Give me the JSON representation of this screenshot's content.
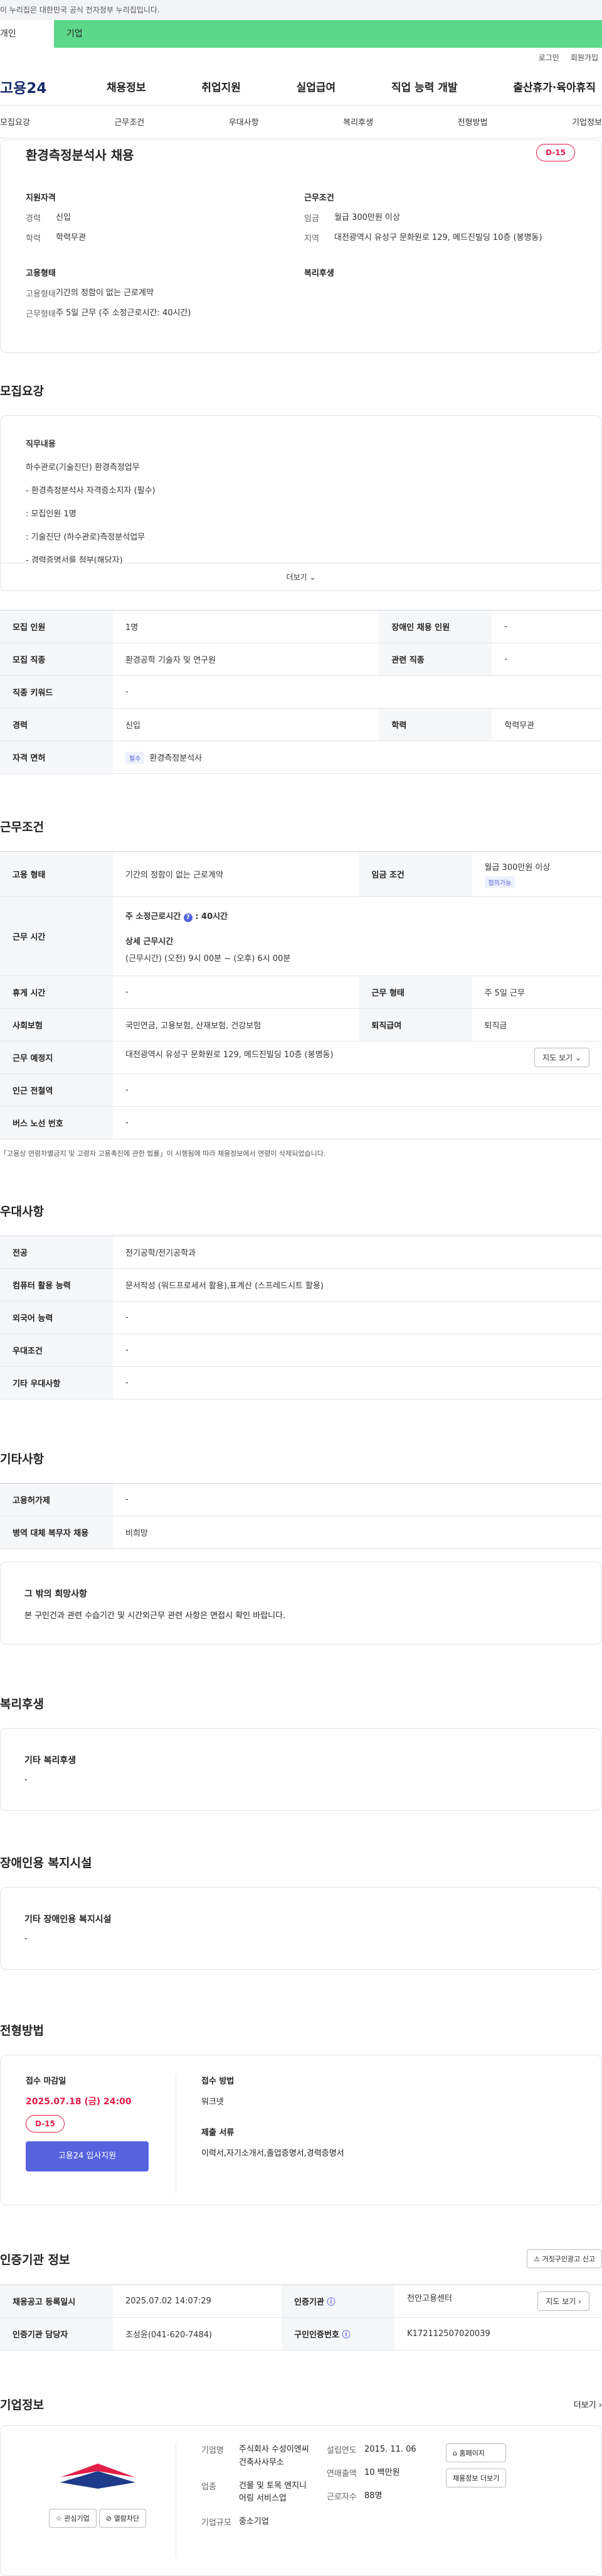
{
  "topbar": {
    "text": "이 누리집은 대한민국 공식 전자정부 누리집입니다."
  },
  "tabs": {
    "a": "개인",
    "b": "기업"
  },
  "util": {
    "login": "로그인",
    "join": "회원가입"
  },
  "gnb": {
    "logo": "고용24",
    "menu": [
      "채용정보",
      "취업지원",
      "실업급여",
      "직업 능력 개발",
      "출산휴가·육아휴직"
    ]
  },
  "anchor": [
    "모집요강",
    "근무조건",
    "우대사항",
    "복리후생",
    "전형방법",
    "기업정보"
  ],
  "summary": {
    "title": "환경측정분석사 채용",
    "dday": "D-15",
    "qual_h": "지원자격",
    "exp_k": "경력",
    "exp_v": "신입",
    "edu_k": "학력",
    "edu_v": "학력무관",
    "cond_h": "근무조건",
    "wage_k": "임금",
    "wage_v": "월급 300만원 이상",
    "region_k": "지역",
    "region_v": "대전광역시 유성구 문화원로 129, 메드진빌딩 10층 (봉명동)",
    "emp_h": "고용형태",
    "emp_k": "고용형태",
    "emp_v": "기간의 정함이 없는 근로계약",
    "work_k": "근무형태",
    "work_v": "주 5일 근무 (주 소정근로시간: 40시간)",
    "welfare_h": "복리후생"
  },
  "recruit": {
    "title": "모집요강",
    "duty_h": "직무내용",
    "lines": [
      "하수관로(기술진단) 환경측정업무",
      "- 환경측정분석사 자격증소지자 (필수)",
      "  : 모집인원 1명",
      "  : 기술진단 (하수관로)측정분석업무",
      "- 경력증명서를 첨부(해당자)"
    ],
    "more": "더보기"
  },
  "recruit_table": {
    "r1": [
      "모집 인원",
      "1명",
      "장애인 채용 인원",
      "-"
    ],
    "r2": [
      "모집 직종",
      "환경공학 기술자 및 연구원",
      "관련 직종",
      "-"
    ],
    "r3": [
      "직종 키워드",
      "-"
    ],
    "r4": [
      "경력",
      "신입",
      "학력",
      "학력무관"
    ],
    "r5": [
      "자격 면허",
      "필수",
      "환경측정분석사"
    ]
  },
  "work": {
    "title": "근무조건",
    "emp": [
      "고용 형태",
      "기간의 정함이 없는 근로계약",
      "임금 조건",
      "월급 300만원 이상",
      "협의가능"
    ],
    "hours_k": "근무 시간",
    "hours_a": "주 소정근로시간",
    "hours_b": ": 40시간",
    "hours_c": "상세 근무시간",
    "hours_d": "(근무시간) (오전) 9시 00분 ~ (오후) 6시 00분",
    "rest": [
      "휴게 시간",
      "-",
      "근무 형태",
      "주 5일 근무"
    ],
    "ins": [
      "사회보험",
      "국민연금, 고용보험, 산재보험, 건강보험",
      "퇴직급여",
      "퇴직금"
    ],
    "place": [
      "근무 예정지",
      "대전광역시 유성구 문화원로 129, 메드진빌딩 10층 (봉명동)",
      "지도 보기"
    ],
    "station": [
      "인근 전철역",
      "-"
    ],
    "bus": [
      "버스 노선 번호",
      "-"
    ],
    "note": "「고용상 연령차별금지 및 고령자 고용촉진에 관한 법률」이 시행됨에 따라 채용정보에서 연령이 삭제되었습니다."
  },
  "pref": {
    "title": "우대사항",
    "rows": [
      [
        "전공",
        "전기공학/전기공학과"
      ],
      [
        "컴퓨터 활용 능력",
        "문서작성 (워드프로세서 활용),표계산 (스프레드시트 활용)"
      ],
      [
        "외국어 능력",
        "-"
      ],
      [
        "우대조건",
        "-"
      ],
      [
        "기타 우대사항",
        "-"
      ]
    ]
  },
  "etc": {
    "title": "기타사항",
    "rows": [
      [
        "고용허가제",
        "-"
      ],
      [
        "병역 대체 복무자 채용",
        "비희망"
      ]
    ],
    "box_h": "그 밖의 희망사항",
    "box_v": "본 구인건과 관련 수습기간 및 시간외근무 관련 사항은 면접시 확인 바랍니다."
  },
  "welfare": {
    "title": "복리후생",
    "h": "기타 복리후생",
    "v": "-"
  },
  "facility": {
    "title": "장애인용 복지시설",
    "h": "기타 장애인용 복지시설",
    "v": "-"
  },
  "method": {
    "title": "전형방법",
    "deadline_h": "접수 마감일",
    "deadline": "2025.07.18 (금) 24:00",
    "dday": "D-15",
    "apply": "고용24 입사지원",
    "way_h": "접수 방법",
    "way_v": "워크넷",
    "docs_h": "제출 서류",
    "docs_v": "이력서,자기소개서,졸업증명서,경력증명서"
  },
  "cert": {
    "title": "인증기관 정보",
    "report": "거짓구인광고 신고",
    "r1": [
      "채용공고 등록일시",
      "2025.07.02 14:07:29",
      "인증기관",
      "천안고용센터",
      "지도 보기"
    ],
    "r2": [
      "인증기관 담당자",
      "조성윤(041-620-7484)",
      "구인인증번호",
      "K172112507020039"
    ]
  },
  "company": {
    "title": "기업정보",
    "more": "더보기",
    "fav": "관심기업",
    "block": "열람차단",
    "name_k": "기업명",
    "name_v": "주식회사 수성이엔씨 건축사사무소",
    "industry_k": "업종",
    "industry_v": "건물 및 토목 엔지니어링 서비스업",
    "size_k": "기업규모",
    "size_v": "중소기업",
    "est_k": "설립연도",
    "est_v": "2015. 11. 06",
    "sales_k": "연매출액",
    "sales_v": "10 백만원",
    "emp_k": "근로자수",
    "emp_v": "88명",
    "home": "홈페이지",
    "other": "채용정보 더보기"
  },
  "colors": {
    "accent": "#5563de",
    "dday": "#e11d48",
    "tab": "#5dd88a"
  }
}
